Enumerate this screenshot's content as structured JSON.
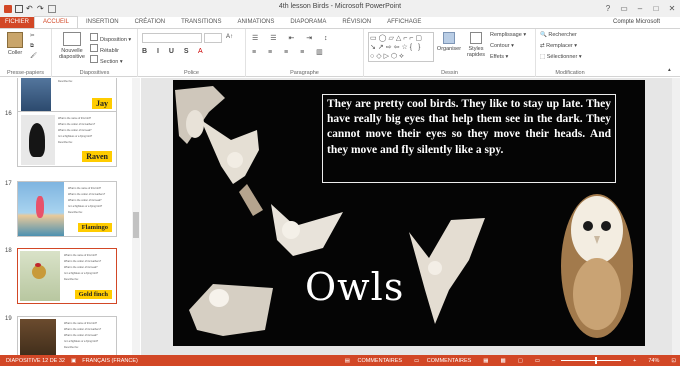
{
  "window": {
    "title": "4th lesson Birds - Microsoft PowerPoint",
    "account": "Compte Microsoft"
  },
  "tabs": [
    "FICHIER",
    "ACCUEIL",
    "INSERTION",
    "CRÉATION",
    "TRANSITIONS",
    "ANIMATIONS",
    "DIAPORAMA",
    "RÉVISION",
    "AFFICHAGE"
  ],
  "ribbon": {
    "clipboard": {
      "paste": "Coller",
      "label": "Presse-papiers"
    },
    "slides": {
      "new_slide": "Nouvelle diapositive",
      "layout": "Disposition",
      "reset": "Rétablir",
      "section": "Section",
      "label": "Diapositives"
    },
    "font": {
      "label": "Police"
    },
    "paragraph": {
      "label": "Paragraphe"
    },
    "drawing": {
      "arrange": "Organiser",
      "quick_styles": "Styles rapides",
      "fill": "Remplissage",
      "outline": "Contour",
      "effects": "Effets",
      "label": "Dessin"
    },
    "editing": {
      "find": "Rechercher",
      "replace": "Remplacer",
      "select": "Sélectionner",
      "label": "Modification"
    }
  },
  "thumbnails": [
    {
      "num": "",
      "label": "Jay"
    },
    {
      "num": "16",
      "label": "Raven"
    },
    {
      "num": "17",
      "label": "Flamingo"
    },
    {
      "num": "18",
      "label": "Gold finch"
    },
    {
      "num": "19",
      "label": ""
    }
  ],
  "thumb_questions": [
    "What is the name of this bird?",
    "What is the colour of its feathers?",
    "What is the colour of its beak?",
    "Is it a flightless or a flying bird?",
    "Describe the:"
  ],
  "slide": {
    "body": "They are pretty cool birds. They like to stay up late. They have really big eyes that help them see in the dark. They cannot move their eyes so they move their heads. And they move and fly silently like a spy.",
    "title": "Owls"
  },
  "status": {
    "slide_info": "DIAPOSITIVE 12 DE 32",
    "language": "FRANÇAIS (FRANCE)",
    "notes": "COMMENTAIRES",
    "comments": "COMMENTAIRES",
    "zoom": "74%"
  }
}
